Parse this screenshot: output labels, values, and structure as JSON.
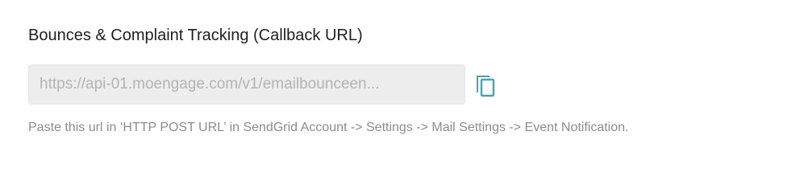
{
  "section": {
    "title": "Bounces & Complaint Tracking (Callback URL)",
    "url_value": "https://api-01.moengage.com/v1/emailbounceen...",
    "copy_icon": "copy-icon",
    "help_text": "Paste this url in ‘HTTP POST URL’ in SendGrid Account -> Settings -> Mail Settings -> Event Notification."
  },
  "colors": {
    "accent": "#4aa3ad",
    "input_bg": "#ededed",
    "title_text": "#1f1f1f",
    "help_text": "#8c8c8c",
    "input_text": "#b4b4b4"
  }
}
